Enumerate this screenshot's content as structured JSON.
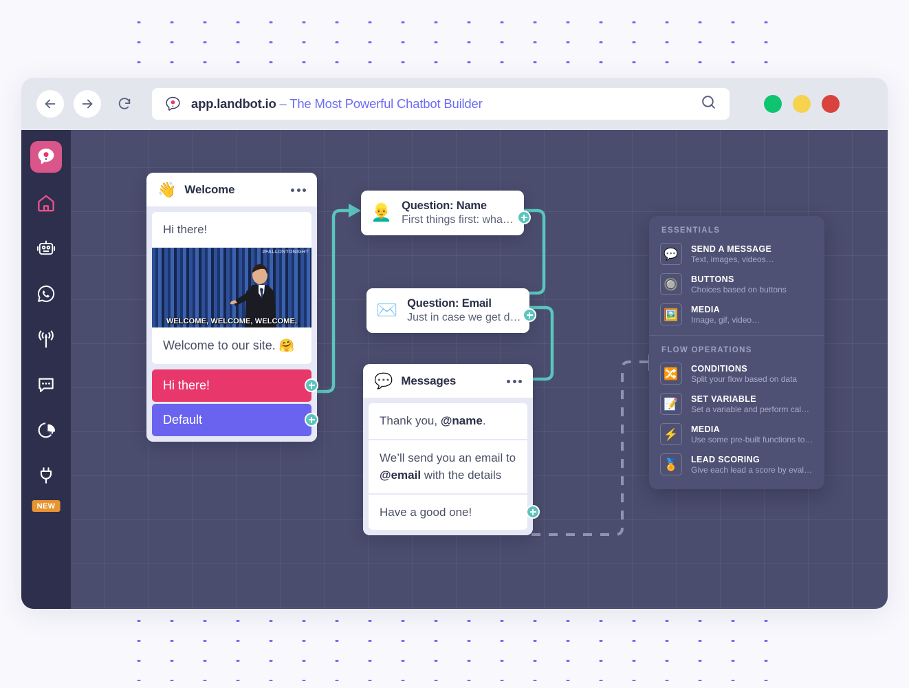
{
  "background": {
    "page_color": "#f8f8fd",
    "dot_color": "#6b6df4"
  },
  "browser": {
    "back_icon": "arrow-left-icon",
    "forward_icon": "arrow-right-icon",
    "reload_icon": "reload-icon",
    "favicon": "landbot-logo-icon",
    "url": "app.landbot.io",
    "url_suffix": " – The Most Powerful Chatbot Builder",
    "search_icon": "search-icon",
    "window_dots": [
      {
        "name": "minimize-dot",
        "color": "#0fc46f"
      },
      {
        "name": "maximize-dot",
        "color": "#f6d24e"
      },
      {
        "name": "close-dot",
        "color": "#d8433e"
      }
    ]
  },
  "sidebar": {
    "background": "#2e2f4d",
    "active_color": "#d9558a",
    "items": [
      {
        "icon": "landbot-logo-icon",
        "label": "Landbot",
        "active": true
      },
      {
        "icon": "home-icon",
        "label": "Home",
        "active": false
      },
      {
        "icon": "robot-icon",
        "label": "Bots",
        "active": false
      },
      {
        "icon": "whatsapp-icon",
        "label": "WhatsApp",
        "active": false
      },
      {
        "icon": "broadcast-icon",
        "label": "Broadcast",
        "active": false
      },
      {
        "icon": "chat-icon",
        "label": "Inbox",
        "active": false
      },
      {
        "icon": "analytics-pie-icon",
        "label": "Analytics",
        "active": false
      },
      {
        "icon": "plug-icon",
        "label": "Integrations",
        "active": false,
        "badge": "NEW"
      }
    ]
  },
  "canvas": {
    "background": "#4b4d6e",
    "connector_color": "#5bc5bd",
    "dashed_connector_color": "#9094ad"
  },
  "welcome_card": {
    "emoji": "👋",
    "title": "Welcome",
    "menu_icon": "more-options-icon",
    "messages": [
      {
        "text": "Hi there!"
      }
    ],
    "gif": {
      "watermark": "#FALLONTONIGHT",
      "caption": "WELCOME, WELCOME, WELCOME,"
    },
    "closing_message": "Welcome to our site. 🤗",
    "choices": [
      {
        "label": "Hi there!",
        "color": "#e8386b",
        "connector_icon": "add-connector-icon"
      },
      {
        "label": "Default",
        "color": "#6a63f0",
        "connector_icon": "add-connector-icon"
      }
    ]
  },
  "question_name_node": {
    "emoji": "👱‍♂️",
    "title": "Question: Name",
    "subtitle": "First things first: wha…",
    "connector_icon": "add-connector-icon"
  },
  "question_email_node": {
    "emoji": "✉️",
    "title": "Question: Email",
    "subtitle": "Just in case we get d…",
    "connector_icon": "add-connector-icon"
  },
  "messages_card": {
    "emoji": "💬",
    "title": "Messages",
    "menu_icon": "more-options-icon",
    "bubbles": [
      {
        "parts": [
          {
            "t": "Thank you, "
          },
          {
            "t": "@name",
            "bold": true
          },
          {
            "t": "."
          }
        ]
      },
      {
        "parts": [
          {
            "t": "We’ll send you an email to "
          },
          {
            "t": "@email",
            "bold": true
          },
          {
            "t": " with the details"
          }
        ]
      },
      {
        "parts": [
          {
            "t": "Have a good one!"
          }
        ]
      }
    ],
    "connector_icon": "add-connector-icon"
  },
  "blocks_panel": {
    "sections": [
      {
        "title": "ESSENTIALS",
        "items": [
          {
            "icon": "💬",
            "icon_name": "speech-bubble-icon",
            "title": "SEND A MESSAGE",
            "subtitle": "Text, images, videos…"
          },
          {
            "icon": "🔘",
            "icon_name": "buttons-icon",
            "title": "BUTTONS",
            "subtitle": "Choices based on buttons"
          },
          {
            "icon": "🖼️",
            "icon_name": "media-frame-icon",
            "title": "MEDIA",
            "subtitle": "Image, gif, video…"
          }
        ]
      },
      {
        "title": "FLOW OPERATIONS",
        "items": [
          {
            "icon": "🔀",
            "icon_name": "shuffle-icon",
            "title": "CONDITIONS",
            "subtitle": "Split your flow based on data"
          },
          {
            "icon": "📝",
            "icon_name": "memo-icon",
            "title": "SET VARIABLE",
            "subtitle": "Set a variable and perform calcul…"
          },
          {
            "icon": "⚡",
            "icon_name": "lightning-icon",
            "title": "MEDIA",
            "subtitle": "Use some pre-built functions to …"
          },
          {
            "icon": "🏅",
            "icon_name": "medal-icon",
            "title": "LEAD SCORING",
            "subtitle": "Give each lead a score by evalua…"
          }
        ]
      }
    ]
  }
}
